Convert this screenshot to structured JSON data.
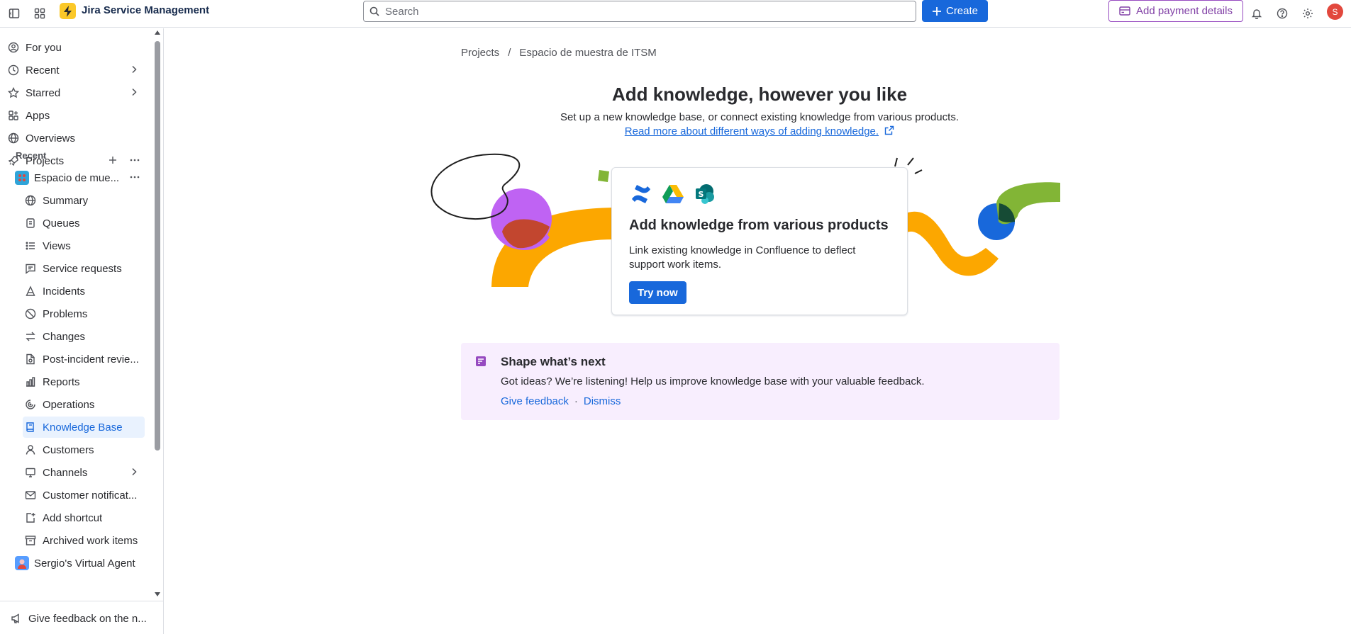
{
  "header": {
    "product_name": "Jira Service Management",
    "search_placeholder": "Search",
    "create_label": "Create",
    "payment_label": "Add payment details",
    "avatar_initial": "S",
    "brand_color": "#1868db",
    "icons": [
      "sidebar-toggle-icon",
      "app-switcher-icon",
      "jsm-logo-icon",
      "search-icon",
      "plus-icon",
      "credit-card-icon",
      "bell-icon",
      "help-icon",
      "gear-icon"
    ]
  },
  "sidebar": {
    "top_items": [
      {
        "label": "For you",
        "icon": "person-circle-icon"
      },
      {
        "label": "Recent",
        "icon": "clock-icon"
      },
      {
        "label": "Starred",
        "icon": "star-icon"
      },
      {
        "label": "Apps",
        "icon": "apps-icon"
      },
      {
        "label": "Overviews",
        "icon": "globe-icon"
      },
      {
        "label": "Projects",
        "icon": "rocket-icon"
      }
    ],
    "recent_label": "Recent",
    "project_name": "Espacio de mue...",
    "project_items": [
      {
        "label": "Summary",
        "icon": "globe-icon"
      },
      {
        "label": "Queues",
        "icon": "queue-icon"
      },
      {
        "label": "Views",
        "icon": "list-icon"
      },
      {
        "label": "Service requests",
        "icon": "message-icon"
      },
      {
        "label": "Incidents",
        "icon": "incident-icon"
      },
      {
        "label": "Problems",
        "icon": "problem-icon"
      },
      {
        "label": "Changes",
        "icon": "swap-icon"
      },
      {
        "label": "Post-incident revie...",
        "icon": "document-icon"
      },
      {
        "label": "Reports",
        "icon": "chart-icon"
      },
      {
        "label": "Operations",
        "icon": "operations-icon"
      },
      {
        "label": "Knowledge Base",
        "icon": "book-icon"
      },
      {
        "label": "Customers",
        "icon": "person-icon"
      },
      {
        "label": "Channels",
        "icon": "monitor-icon"
      },
      {
        "label": "Customer notificat...",
        "icon": "mail-icon"
      },
      {
        "label": "Add shortcut",
        "icon": "add-shortcut-icon"
      },
      {
        "label": "Archived work items",
        "icon": "archive-icon"
      }
    ],
    "second_project": "Sergio's Virtual Agent",
    "footer_label": "Give feedback on the n..."
  },
  "main": {
    "breadcrumb": {
      "root": "Projects",
      "separator": "/",
      "current": "Espacio de muestra de ITSM"
    },
    "title": "Add knowledge, however you like",
    "subtitle": "Set up a new knowledge base, or connect existing knowledge from various products.",
    "read_more": "Read more about different ways of adding knowledge.",
    "card": {
      "logos": [
        "confluence-logo-icon",
        "google-drive-logo-icon",
        "sharepoint-logo-icon"
      ],
      "title": "Add knowledge from various products",
      "description": "Link existing knowledge in Confluence to deflect support work items.",
      "button": "Try now"
    },
    "feedback": {
      "title": "Shape what’s next",
      "text": "Got ideas? We’re listening! Help us improve knowledge base with your valuable feedback.",
      "give_feedback": "Give feedback",
      "separator": "·",
      "dismiss": "Dismiss",
      "background": "#f8eefe"
    }
  }
}
